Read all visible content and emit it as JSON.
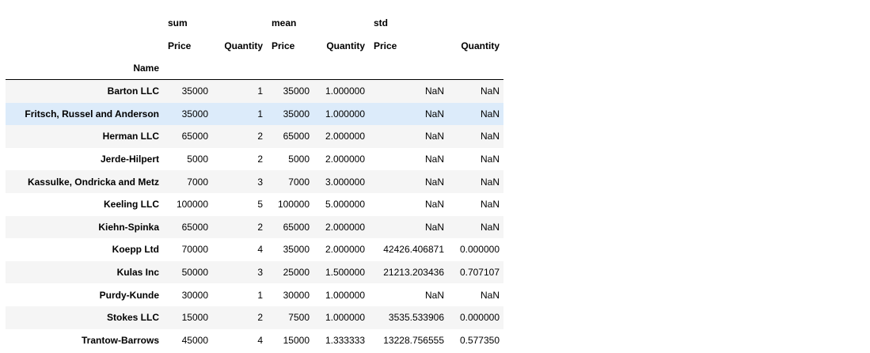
{
  "table": {
    "header_level0": [
      "sum",
      "mean",
      "std"
    ],
    "header_level1": [
      "Price",
      "Quantity",
      "Price",
      "Quantity",
      "Price",
      "Quantity"
    ],
    "index_name": "Name",
    "hovered_row": 1,
    "rows": [
      {
        "name": "Barton LLC",
        "cells": [
          "35000",
          "1",
          "35000",
          "1.000000",
          "NaN",
          "NaN"
        ]
      },
      {
        "name": "Fritsch, Russel and Anderson",
        "cells": [
          "35000",
          "1",
          "35000",
          "1.000000",
          "NaN",
          "NaN"
        ]
      },
      {
        "name": "Herman LLC",
        "cells": [
          "65000",
          "2",
          "65000",
          "2.000000",
          "NaN",
          "NaN"
        ]
      },
      {
        "name": "Jerde-Hilpert",
        "cells": [
          "5000",
          "2",
          "5000",
          "2.000000",
          "NaN",
          "NaN"
        ]
      },
      {
        "name": "Kassulke, Ondricka and Metz",
        "cells": [
          "7000",
          "3",
          "7000",
          "3.000000",
          "NaN",
          "NaN"
        ]
      },
      {
        "name": "Keeling LLC",
        "cells": [
          "100000",
          "5",
          "100000",
          "5.000000",
          "NaN",
          "NaN"
        ]
      },
      {
        "name": "Kiehn-Spinka",
        "cells": [
          "65000",
          "2",
          "65000",
          "2.000000",
          "NaN",
          "NaN"
        ]
      },
      {
        "name": "Koepp Ltd",
        "cells": [
          "70000",
          "4",
          "35000",
          "2.000000",
          "42426.406871",
          "0.000000"
        ]
      },
      {
        "name": "Kulas Inc",
        "cells": [
          "50000",
          "3",
          "25000",
          "1.500000",
          "21213.203436",
          "0.707107"
        ]
      },
      {
        "name": "Purdy-Kunde",
        "cells": [
          "30000",
          "1",
          "30000",
          "1.000000",
          "NaN",
          "NaN"
        ]
      },
      {
        "name": "Stokes LLC",
        "cells": [
          "15000",
          "2",
          "7500",
          "1.000000",
          "3535.533906",
          "0.000000"
        ]
      },
      {
        "name": "Trantow-Barrows",
        "cells": [
          "45000",
          "4",
          "15000",
          "1.333333",
          "13228.756555",
          "0.577350"
        ]
      }
    ]
  }
}
